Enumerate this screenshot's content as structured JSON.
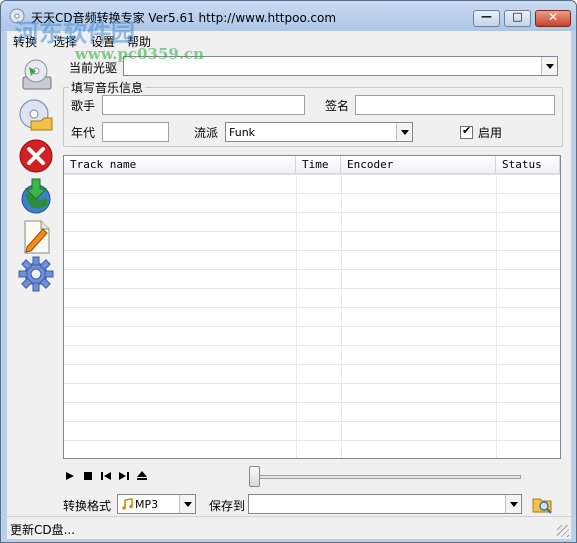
{
  "window": {
    "title": "天天CD音频转换专家 Ver5.61    http://www.httpoo.com",
    "controls": {
      "minimize": "—",
      "maximize": "□",
      "close": "✕"
    }
  },
  "watermark": {
    "text": "河东软件园",
    "url": "www.pc0359.cn"
  },
  "menu": {
    "items": [
      "转换",
      "选择",
      "设置",
      "帮助"
    ]
  },
  "toolbar": {
    "icons": [
      "cd-drive-icon",
      "cd-folder-icon",
      "stop-icon",
      "download-globe-icon",
      "edit-document-icon",
      "settings-gear-icon"
    ]
  },
  "drive": {
    "label": "当前光驱",
    "value": ""
  },
  "music_info": {
    "group_title": "填写音乐信息",
    "artist_label": "歌手",
    "artist_value": "",
    "album_label": "签名",
    "album_value": "",
    "year_label": "年代",
    "year_value": "",
    "genre_label": "流派",
    "genre_value": "Funk",
    "enable_label": "启用",
    "enable_checked": true
  },
  "track_list": {
    "columns": [
      "Track name",
      "Time",
      "Encoder",
      "Status"
    ],
    "rows": []
  },
  "player": {
    "buttons": [
      "play",
      "stop",
      "previous",
      "next",
      "eject"
    ],
    "position": 0
  },
  "output": {
    "format_label": "转换格式",
    "format_value": "MP3",
    "save_label": "保存到",
    "save_value": ""
  },
  "status": {
    "text": "更新CD盘..."
  },
  "colors": {
    "title_bar": "#b9cfea",
    "close_button": "#c7402a",
    "stop_icon": "#d42020",
    "gear_icon": "#6f8fd8",
    "globe_icon": "#2c8c3c"
  }
}
